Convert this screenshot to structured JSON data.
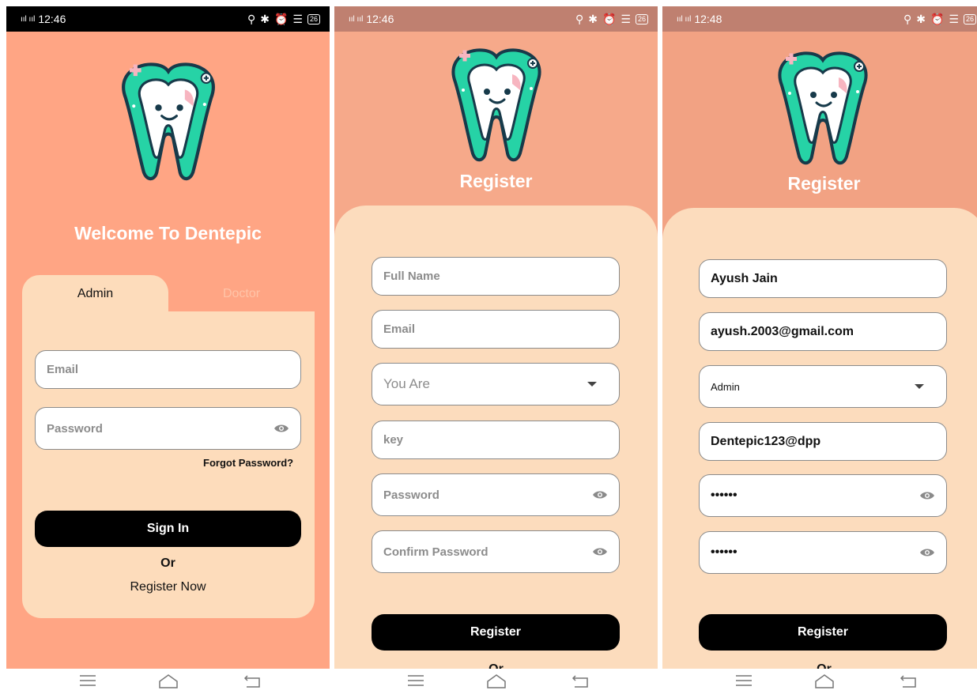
{
  "colors": {
    "accent": "#000000",
    "background_login": "#ffa584",
    "background_register": "#f6a98a",
    "card": "#fddcbb"
  },
  "screens": [
    {
      "status": {
        "signal": "ııl ııl",
        "time": "12:46",
        "battery": "26"
      },
      "title": "Welcome To Dentepic",
      "tabs": {
        "admin": "Admin",
        "doctor": "Doctor"
      },
      "email_placeholder": "Email",
      "password_placeholder": "Password",
      "forgot": "Forgot Password?",
      "signin": "Sign In",
      "or": "Or",
      "register_now": "Register Now"
    },
    {
      "status": {
        "signal": "ııl ııl",
        "time": "12:46",
        "battery": "26"
      },
      "title": "Register",
      "fullname_placeholder": "Full Name",
      "email_placeholder": "Email",
      "role_placeholder": "You Are",
      "key_placeholder": "key",
      "password_placeholder": "Password",
      "confirm_placeholder": "Confirm Password",
      "register": "Register",
      "or": "Or"
    },
    {
      "status": {
        "signal": "ııl ııl",
        "time": "12:48",
        "battery": "26"
      },
      "title": "Register",
      "fullname_value": "Ayush Jain",
      "email_value": "ayush.2003@gmail.com",
      "role_value": "Admin",
      "key_value": "Dentepic123@dpp",
      "password_value": "••••••",
      "confirm_value": "••••••",
      "register": "Register",
      "or": "Or"
    }
  ]
}
